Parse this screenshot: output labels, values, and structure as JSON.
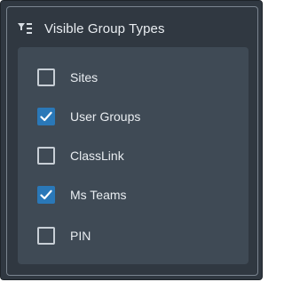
{
  "panel": {
    "title": "Visible Group Types",
    "icon": "filter-list-icon"
  },
  "items": [
    {
      "label": "Sites",
      "checked": false
    },
    {
      "label": "User Groups",
      "checked": true
    },
    {
      "label": "ClassLink",
      "checked": false
    },
    {
      "label": "Ms Teams",
      "checked": true
    },
    {
      "label": "PIN",
      "checked": false
    }
  ],
  "colors": {
    "panel_bg": "#303841",
    "list_bg": "#3f4a55",
    "checkbox_checked": "#2a78b8",
    "text": "#e9edf1"
  }
}
